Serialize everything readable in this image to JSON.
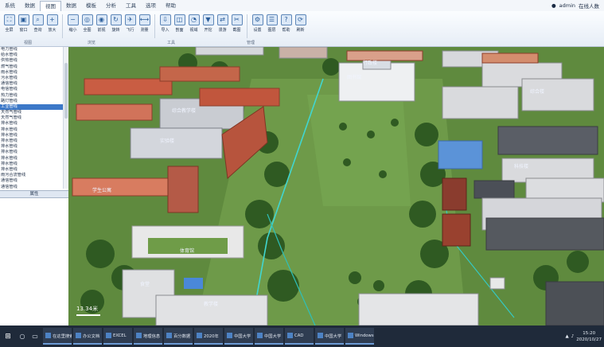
{
  "menubar": {
    "items": [
      "系统",
      "数据",
      "视图",
      "数据",
      "模板",
      "分析",
      "工具",
      "选项",
      "帮助"
    ],
    "active_index": 2,
    "user": "admin",
    "user_right": "在线人数"
  },
  "ribbon": {
    "buttons": [
      "全屏",
      "窗口",
      "查询",
      "放大",
      "缩小",
      "全图",
      "前视",
      "旋转",
      "飞行",
      "测量",
      "导入",
      "剖面",
      "视域",
      "开挖",
      "漫游",
      "截图",
      "设置",
      "图层",
      "帮助",
      "刷新"
    ],
    "groups": [
      "视图",
      "浏览",
      "工具",
      "管理"
    ]
  },
  "tree": {
    "items": [
      "电力管线",
      "给水管线",
      "供热管线",
      "燃气管线",
      "雨水管线",
      "污水管线",
      "通信管线",
      "电信管线",
      "热力管线",
      "路灯管线",
      "工业管线",
      "天然气管线",
      "天然气管线",
      "排水管线",
      "排水管线",
      "排水管线",
      "排水管线",
      "排水管线",
      "排水管线",
      "排水管线",
      "排水管线",
      "排水管线",
      "雨污合流管线",
      "通信管线",
      "通信管线",
      "通信管线",
      "电力管线"
    ],
    "selected_index": 10
  },
  "attr_panel": {
    "title": "属性"
  },
  "viewport": {
    "scale_text": "13.34米",
    "building_labels": [
      "综合教学楼",
      "图书馆",
      "实验楼",
      "学生公寓",
      "体育馆",
      "行政楼",
      "食堂",
      "教学楼",
      "综合楼",
      "科技楼"
    ]
  },
  "taskbar": {
    "search": "search",
    "tasks": [
      "在这里搜索",
      "办公文档",
      "EXCEL",
      "地理信息",
      "百分数据",
      "2020年",
      "中国大学",
      "中国大学",
      "CAD",
      "中国大学",
      "Windows"
    ],
    "time": "15:20",
    "date": "2020/10/27"
  }
}
